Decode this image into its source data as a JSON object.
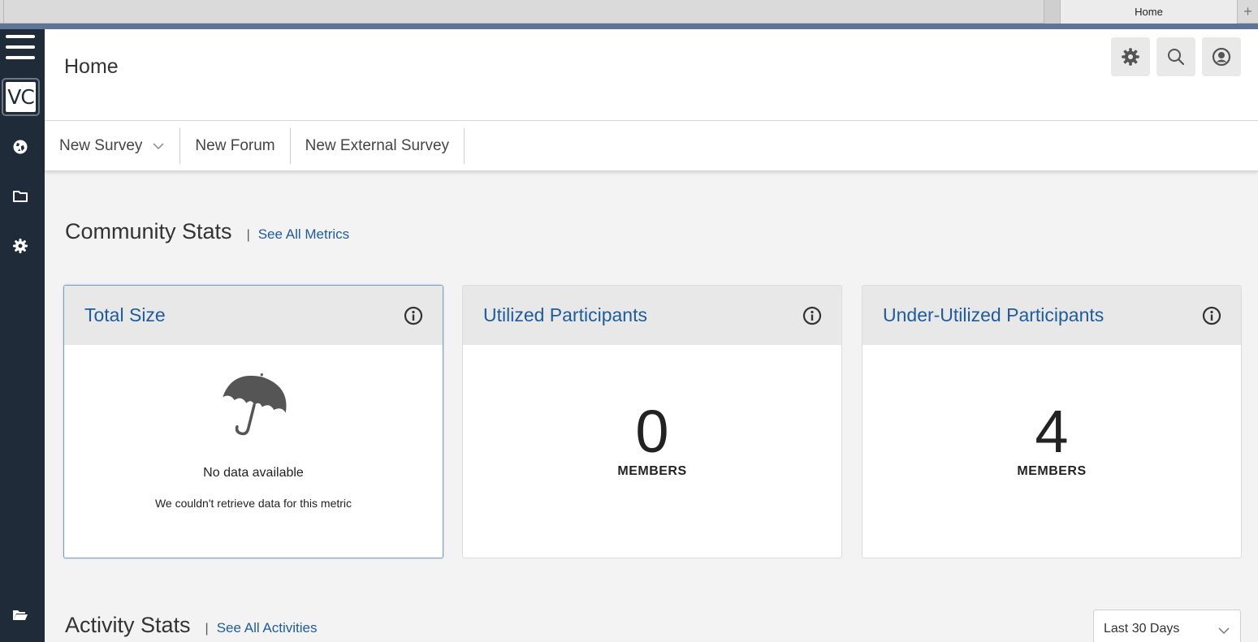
{
  "browser": {
    "active_tab_title": "Home",
    "new_tab_symbol": "+"
  },
  "rail": {
    "logo_text": "VC",
    "icons": [
      "globe-icon",
      "folder-icon",
      "gear-icon",
      "open-folder-icon"
    ]
  },
  "header": {
    "title": "Home",
    "buttons": [
      "settings-icon",
      "search-icon",
      "user-profile-icon"
    ]
  },
  "toolbar": {
    "new_survey": "New Survey",
    "new_forum": "New Forum",
    "new_external_survey": "New External Survey"
  },
  "community_stats": {
    "title": "Community Stats",
    "separator": "|",
    "link": "See All Metrics",
    "cards": [
      {
        "title": "Total Size",
        "empty_title": "No data available",
        "empty_message": "We couldn't retrieve data for this metric"
      },
      {
        "title": "Utilized Participants",
        "value": "0",
        "unit": "MEMBERS"
      },
      {
        "title": "Under-Utilized Participants",
        "value": "4",
        "unit": "MEMBERS"
      }
    ]
  },
  "activity_stats": {
    "title": "Activity Stats",
    "separator": "|",
    "link": "See All Activities",
    "range_selected": "Last 30 Days"
  },
  "colors": {
    "rail_bg": "#1f2b38",
    "accent_bar": "#5f7598",
    "link_blue": "#1f5c99",
    "card_header_bg": "#e8e8e8",
    "page_bg": "#f3f3f3"
  }
}
